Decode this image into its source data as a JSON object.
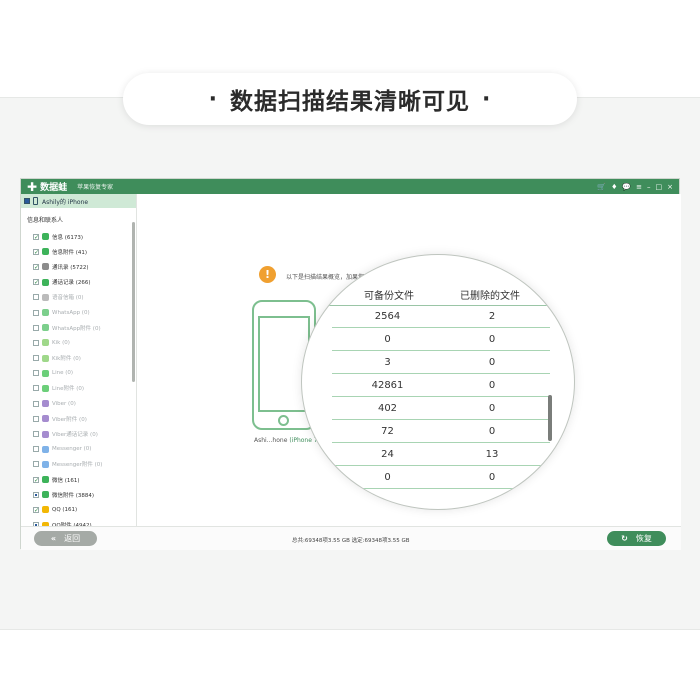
{
  "headline": "数据扫描结果清晰可见",
  "headline_bullet": "·",
  "titlebar": {
    "logo": "✚",
    "app_name": "数据蛙",
    "subtitle": "苹果恢复专家",
    "controls": [
      "🛒",
      "♦",
      "💬",
      "≡",
      "–",
      "□",
      "×"
    ]
  },
  "sidebar": {
    "device": "Ashily的 iPhone",
    "section_title": "信息和联系人",
    "items": [
      {
        "label": "信息 (6173)",
        "state": "checked",
        "icon_color": "#3db35a"
      },
      {
        "label": "信息附件 (41)",
        "state": "checked",
        "icon_color": "#3db35a"
      },
      {
        "label": "通讯录 (5722)",
        "state": "checked",
        "icon_color": "#8c8c8c"
      },
      {
        "label": "通话记录 (266)",
        "state": "checked",
        "icon_color": "#3db35a"
      },
      {
        "label": "语音信箱 (0)",
        "state": "empty",
        "icon_color": "#bbbbbb"
      },
      {
        "label": "WhatsApp (0)",
        "state": "empty",
        "icon_color": "#7ccf8c"
      },
      {
        "label": "WhatsApp附件 (0)",
        "state": "empty",
        "icon_color": "#7ccf8c"
      },
      {
        "label": "Kik (0)",
        "state": "empty",
        "icon_color": "#9fd88a"
      },
      {
        "label": "Kik附件 (0)",
        "state": "empty",
        "icon_color": "#9fd88a"
      },
      {
        "label": "Line (0)",
        "state": "empty",
        "icon_color": "#6ccf7a"
      },
      {
        "label": "Line附件 (0)",
        "state": "empty",
        "icon_color": "#6ccf7a"
      },
      {
        "label": "Viber (0)",
        "state": "empty",
        "icon_color": "#a58ccf"
      },
      {
        "label": "Viber附件 (0)",
        "state": "empty",
        "icon_color": "#a58ccf"
      },
      {
        "label": "Viber通话记录 (0)",
        "state": "empty",
        "icon_color": "#a58ccf"
      },
      {
        "label": "Messenger (0)",
        "state": "empty",
        "icon_color": "#7fb2e8"
      },
      {
        "label": "Messenger附件 (0)",
        "state": "empty",
        "icon_color": "#7fb2e8"
      },
      {
        "label": "微信 (161)",
        "state": "checked",
        "icon_color": "#3db35a"
      },
      {
        "label": "微信附件 (3884)",
        "state": "partial",
        "icon_color": "#3db35a"
      },
      {
        "label": "QQ (161)",
        "state": "checked",
        "icon_color": "#f2b705"
      },
      {
        "label": "QQ附件 (4942)",
        "state": "partial",
        "icon_color": "#f2b705"
      }
    ]
  },
  "main": {
    "notice": "以下是扫描结果概览，加果您",
    "warning_glyph": "!",
    "phone_caption_name": "Ashi...hone",
    "phone_caption_model": "(iPhone 7)"
  },
  "magnifier": {
    "col_backupable": "可备份文件",
    "col_deleted": "已删除的文件",
    "rows": [
      {
        "backupable": "2564",
        "deleted": "2"
      },
      {
        "backupable": "0",
        "deleted": "0"
      },
      {
        "backupable": "3",
        "deleted": "0"
      },
      {
        "backupable": "42861",
        "deleted": "0"
      },
      {
        "backupable": "402",
        "deleted": "0"
      },
      {
        "backupable": "72",
        "deleted": "0"
      },
      {
        "backupable": "24",
        "deleted": "13"
      },
      {
        "backupable": "0",
        "deleted": "0"
      }
    ]
  },
  "footer": {
    "back_arrow": "«",
    "back_label": "返回",
    "summary": "总共:69348项3.55 GB 选定:69348项3.55 GB",
    "restore_icon": "↻",
    "restore_label": "恢复"
  }
}
